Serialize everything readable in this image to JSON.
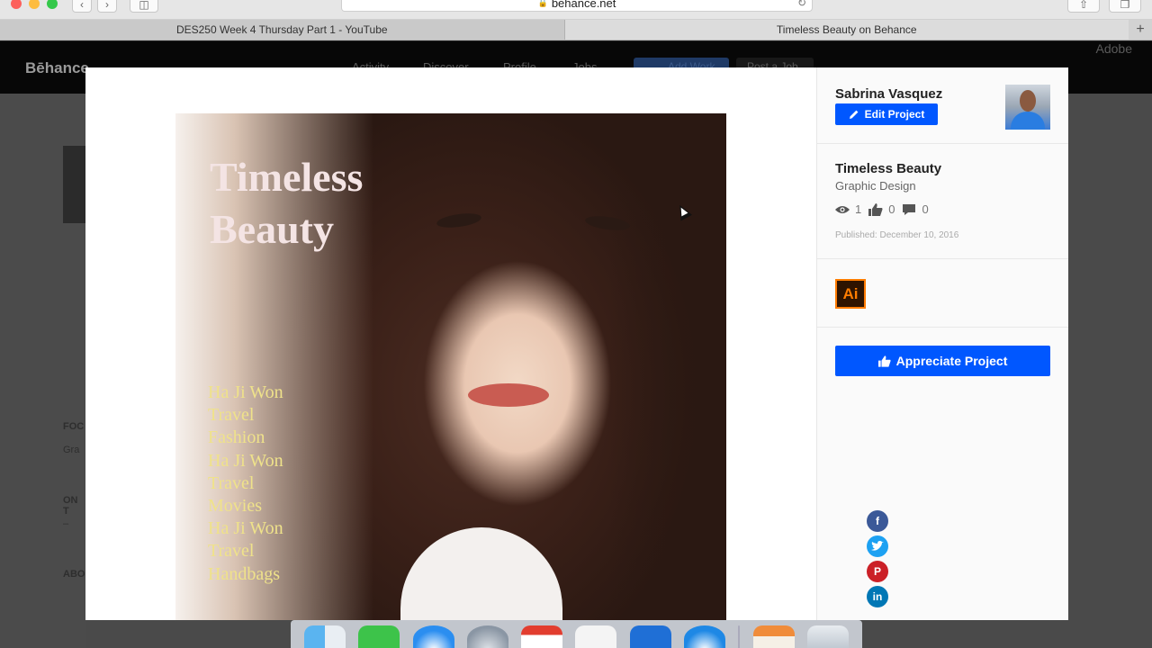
{
  "browser": {
    "address": "behance.net",
    "tabs": [
      {
        "label": "DES250 Week 4 Thursday Part 1 - YouTube"
      },
      {
        "label": "Timeless Beauty on Behance"
      }
    ]
  },
  "background_page": {
    "logo": "Bēhance",
    "nav": [
      "Activity",
      "Discover",
      "Profile",
      "Jobs"
    ],
    "buttons": [
      "Add Work",
      "Post a Job"
    ],
    "adobe": "Adobe",
    "side_labels": [
      "FOC",
      "Gra",
      "ON T",
      "–",
      "ABO"
    ]
  },
  "project": {
    "cover": {
      "title": "Timeless\nBeauty",
      "lines": [
        "Ha Ji Won",
        "Travel",
        "Fashion",
        "Ha Ji Won",
        "Travel",
        "Movies",
        "Ha Ji Won",
        "Travel",
        "Handbags"
      ]
    },
    "owner": {
      "name": "Sabrina Vasquez",
      "edit_label": "Edit Project"
    },
    "title": "Timeless Beauty",
    "field": "Graphic Design",
    "stats": {
      "views": "1",
      "appreciations": "0",
      "comments": "0"
    },
    "published": "Published: December 10, 2016",
    "tool": "Ai",
    "appreciate_label": "Appreciate Project"
  },
  "colors": {
    "accent": "#0057ff",
    "ai_orange": "#ff7c00",
    "ai_bg": "#2e1300"
  },
  "icons": {
    "edit": "pencil-icon",
    "views": "eye-icon",
    "appreciations": "thumbs-up-icon",
    "comments": "comment-icon",
    "share": [
      "facebook-icon",
      "twitter-icon",
      "pinterest-icon",
      "linkedin-icon"
    ]
  }
}
